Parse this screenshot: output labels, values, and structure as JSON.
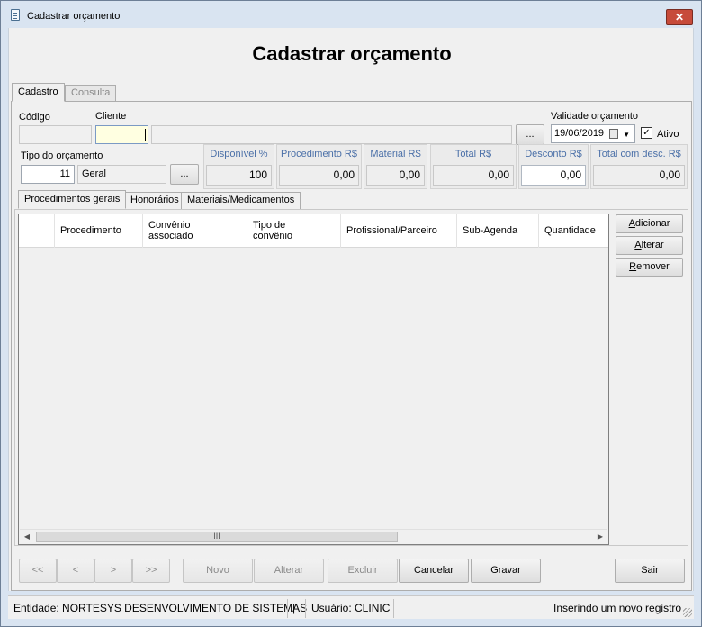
{
  "window": {
    "title": "Cadastrar orçamento",
    "close_glyph": "✕"
  },
  "heading": "Cadastrar orçamento",
  "main_tabs": [
    {
      "label": "Cadastro",
      "active": true
    },
    {
      "label": "Consulta",
      "active": false
    }
  ],
  "form": {
    "codigo_label": "Código",
    "codigo_value": "",
    "cliente_label": "Cliente",
    "cliente_value": "",
    "cliente_name": "",
    "ellipsis": "...",
    "validade_label": "Validade orçamento",
    "validade_value": "19/06/2019",
    "ativo_label": "Ativo",
    "ativo_checked": "✓",
    "tipo_label": "Tipo do orçamento",
    "tipo_code": "11",
    "tipo_name": "Geral"
  },
  "totals": [
    {
      "label": "Disponível %",
      "value": "100"
    },
    {
      "label": "Procedimento R$",
      "value": "0,00"
    },
    {
      "label": "Material R$",
      "value": "0,00"
    },
    {
      "label": "Total R$",
      "value": "0,00"
    },
    {
      "label": "Desconto R$",
      "value": "0,00"
    },
    {
      "label": "Total com desc. R$",
      "value": "0,00"
    }
  ],
  "sub_tabs": [
    {
      "label": "Procedimentos gerais",
      "active": true
    },
    {
      "label": "Honorários",
      "active": false
    },
    {
      "label": "Materiais/Medicamentos",
      "active": false
    }
  ],
  "grid": {
    "columns": [
      "",
      "Procedimento",
      "Convênio\nassociado",
      "Tipo de\nconvênio",
      "Profissional/Parceiro",
      "Sub-Agenda",
      "Quantidade"
    ],
    "rows": [],
    "scroll_thumb": "III",
    "scroll_left": "◀",
    "scroll_right": "▶"
  },
  "side_buttons": [
    {
      "label": "Adicionar",
      "access": "A"
    },
    {
      "label": "Alterar",
      "access": "A"
    },
    {
      "label": "Remover",
      "access": "R"
    }
  ],
  "nav_buttons": [
    "<<",
    "<",
    ">",
    ">>"
  ],
  "action_buttons": [
    {
      "label": "Novo",
      "enabled": false
    },
    {
      "label": "Alterar",
      "enabled": false
    },
    {
      "label": "Excluir",
      "enabled": false
    },
    {
      "label": "Cancelar",
      "enabled": true
    },
    {
      "label": "Gravar",
      "enabled": true
    }
  ],
  "exit_button": "Sair",
  "status": {
    "entidade": "Entidade: NORTESYS DESENVOLVIMENTO DE SISTEMAS",
    "pipe": "|",
    "usuario": "Usuário: CLINIC",
    "mode": "Inserindo um novo registro"
  }
}
